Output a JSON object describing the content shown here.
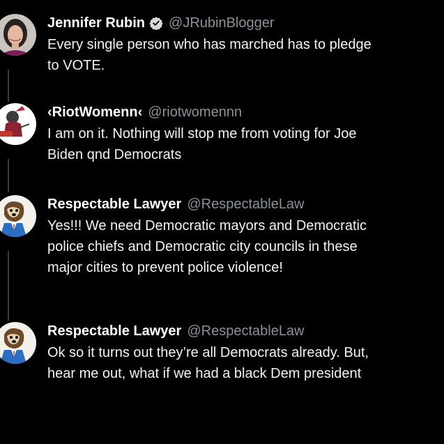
{
  "tweets": [
    {
      "name": "Jennifer Rubin",
      "verified": true,
      "handle": "@JRubinBlogger",
      "text": "Every single person who has marched has to pledge\nto VOTE.",
      "avatar_icon": "user-photo-icon"
    },
    {
      "name": "‹RiotWomenn‹",
      "verified": false,
      "handle": "@riotwomennn",
      "text": "I am on it.  Nothing will stop me from voting for Joe\nBiden qnd Democrats",
      "avatar_icon": "riot-women-logo-icon"
    },
    {
      "name": "Respectable Lawyer",
      "verified": false,
      "handle": "@RespectableLaw",
      "text": "Yes!!! We need Democratic mayors and Democratic\npolice chiefs and Democratic city councils in these\nmajor cities to prevent police violence!",
      "avatar_icon": "cartoon-dog-icon"
    },
    {
      "name": "Respectable Lawyer",
      "verified": false,
      "handle": "@RespectableLaw",
      "text": "Ok so it turns out they’re all Democrats already. But,\nhear me out, what if we had a black Dem president",
      "avatar_icon": "cartoon-dog-icon"
    }
  ],
  "colors": {
    "background": "#000000",
    "text": "#f2f2f2",
    "handle": "#8b9199",
    "verified": "#d9d9d9",
    "thread_line": "#3a3d41"
  }
}
